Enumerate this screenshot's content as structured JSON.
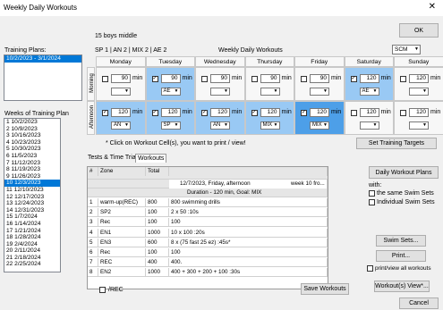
{
  "window": {
    "title": "Weekly Daily Workouts",
    "close": "✕"
  },
  "ok": "OK",
  "cancel": "Cancel",
  "group_name": "15 boys middle",
  "sp_line": "SP 1  | AN 2  | MIX 2  | AE 2",
  "grid_title": "Weekly Daily Workouts",
  "course": "SCM",
  "training_plans_label": "Training Plans:",
  "training_plans": [
    "10/2/2023 - 3/1/2024"
  ],
  "weeks_label": "Weeks of Training Plan",
  "weeks": [
    "1 10/2/2023",
    "2 10/9/2023",
    "3 10/16/2023",
    "4 10/23/2023",
    "5 10/30/2023",
    "6 11/5/2023",
    "7 11/12/2023",
    "8 11/19/2023",
    "9 11/26/2023",
    "10 12/3/2023",
    "11 12/10/2023",
    "12 12/17/2023",
    "13 12/24/2023",
    "14 12/31/2023",
    "15 1/7/2024",
    "16 1/14/2024",
    "17 1/21/2024",
    "18 1/28/2024",
    "19 2/4/2024",
    "20 2/11/2024",
    "21 2/18/2024",
    "22 2/25/2024"
  ],
  "selected_week_index": 9,
  "days": [
    "Monday",
    "Tuesday",
    "Wednesday",
    "Thursday",
    "Friday",
    "Saturday",
    "Sunday"
  ],
  "rows": {
    "morning": "Morning",
    "afternoon": "Afternoon"
  },
  "min_label": "min",
  "morning": [
    {
      "checked": false,
      "min": "90",
      "type": ""
    },
    {
      "checked": true,
      "min": "90",
      "type": "AE"
    },
    {
      "checked": false,
      "min": "90",
      "type": ""
    },
    {
      "checked": false,
      "min": "90",
      "type": ""
    },
    {
      "checked": false,
      "min": "90",
      "type": ""
    },
    {
      "checked": true,
      "min": "120",
      "type": "AE"
    },
    {
      "checked": false,
      "min": "120",
      "type": ""
    }
  ],
  "afternoon": [
    {
      "checked": true,
      "min": "120",
      "type": "AN"
    },
    {
      "checked": true,
      "min": "120",
      "type": "SP"
    },
    {
      "checked": true,
      "min": "120",
      "type": "AN"
    },
    {
      "checked": true,
      "min": "120",
      "type": "MIX"
    },
    {
      "checked": true,
      "min": "120",
      "type": "MIX"
    },
    {
      "checked": false,
      "min": "120",
      "type": ""
    },
    {
      "checked": false,
      "min": "120",
      "type": ""
    }
  ],
  "hint": "* Click on Workout Cell(s), you want to print / view!",
  "set_targets": "Set Training Targets",
  "tabs": [
    "Tests & Time Trials",
    "Workouts"
  ],
  "table": {
    "headers": [
      "#",
      "Zone",
      "Total",
      ""
    ],
    "info1": "12/7/2023, Friday, afternoon",
    "info1b": "week 10 fro...",
    "info2": "Duration - 120 min,   Goal: MIX",
    "rows": [
      [
        "1",
        "warm-up(REC)",
        "800",
        "800 swimming drills"
      ],
      [
        "2",
        "SP2",
        "100",
        "2 x 50 :10s"
      ],
      [
        "3",
        "Rec",
        "100",
        "100"
      ],
      [
        "4",
        "EN1",
        "1000",
        "10 x 100 :20s"
      ],
      [
        "5",
        "EN3",
        "600",
        "8 x (75 fast 25 ez) :45s*"
      ],
      [
        "6",
        "Rec",
        "100",
        "100"
      ],
      [
        "7",
        "REC",
        "400",
        "400."
      ],
      [
        "8",
        "EN2",
        "1000",
        "400 + 300 + 200 + 100 :30s"
      ]
    ]
  },
  "irec": "/REC",
  "save_workouts": "Save Workouts",
  "daily_plans": "Daily Workout Plans",
  "with": "with:",
  "same_sets": "the same Swim Sets",
  "indiv_sets": "Individual Swim Sets",
  "swim_sets": "Swim Sets...",
  "print": "Print...",
  "printview": "print/view all workouts",
  "workouts_view": "Workout(s) View*..."
}
